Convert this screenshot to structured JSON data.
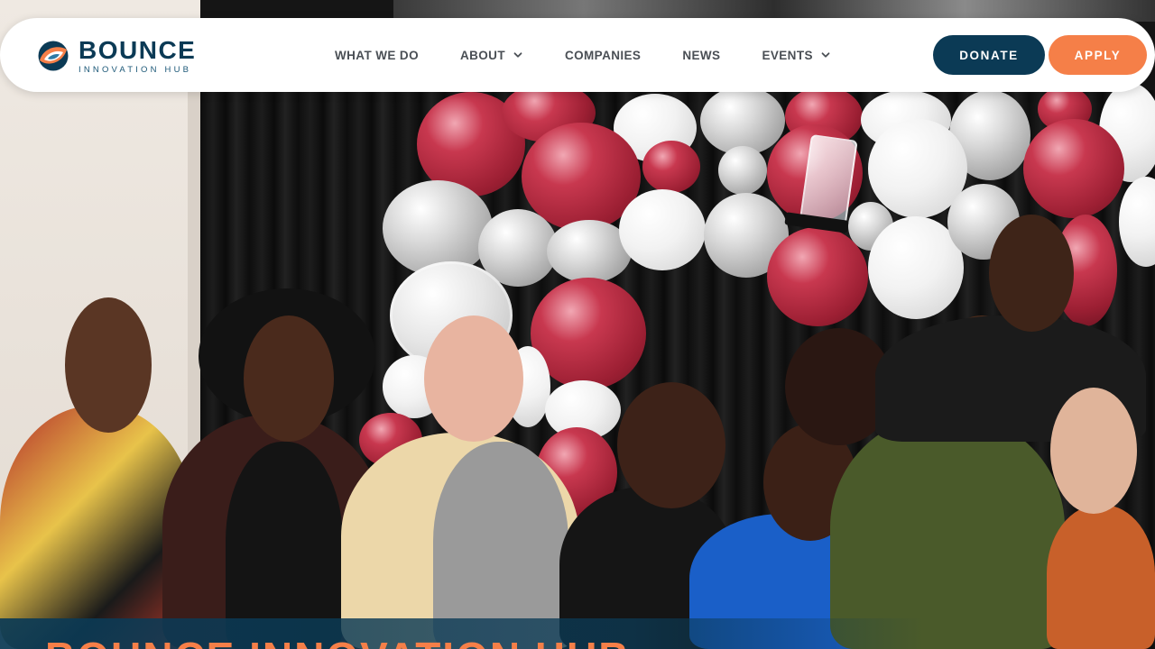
{
  "brand": {
    "name": "BOUNCE",
    "tagline": "INNOVATION HUB",
    "colors": {
      "navy": "#0b3a55",
      "orange": "#f57f48"
    }
  },
  "nav": {
    "items": [
      {
        "label": "WHAT WE DO",
        "has_dropdown": false
      },
      {
        "label": "ABOUT",
        "has_dropdown": true
      },
      {
        "label": "COMPANIES",
        "has_dropdown": false
      },
      {
        "label": "NEWS",
        "has_dropdown": false
      },
      {
        "label": "EVENTS",
        "has_dropdown": true
      }
    ],
    "dropdown_icon": "chevron-down-icon"
  },
  "actions": {
    "donate_label": "DONATE",
    "apply_label": "APPLY"
  },
  "hero": {
    "headline": "BOUNCE INNOVATION HUB"
  }
}
